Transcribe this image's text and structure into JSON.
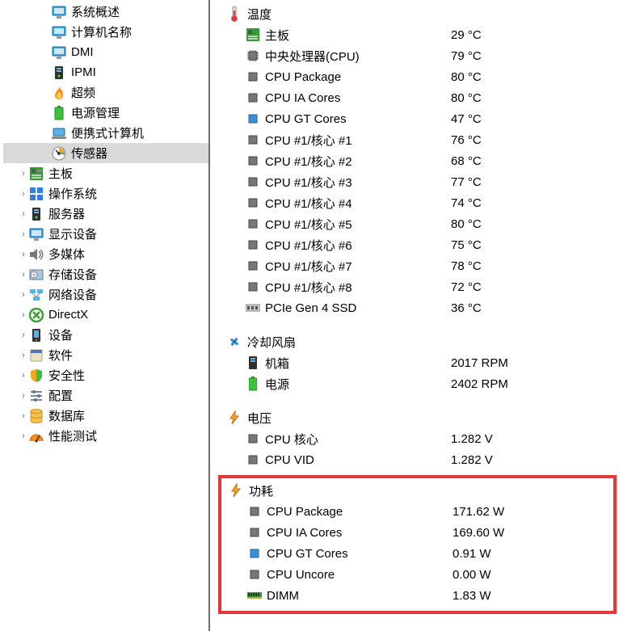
{
  "tree": {
    "overview": "系统概述",
    "computer": "计算机名称",
    "dmi": "DMI",
    "ipmi": "IPMI",
    "overclock": "超频",
    "power_mgmt": "电源管理",
    "portable": "便携式计算机",
    "sensors": "传感器",
    "mainboard": "主板",
    "os": "操作系统",
    "server": "服务器",
    "display": "显示设备",
    "multimedia": "多媒体",
    "storage": "存储设备",
    "network": "网络设备",
    "directx": "DirectX",
    "devices": "设备",
    "software": "软件",
    "security": "安全性",
    "config": "配置",
    "database": "数据库",
    "benchmark": "性能测试"
  },
  "sections": {
    "temp": {
      "title": "温度"
    },
    "cooling": {
      "title": "冷却风扇"
    },
    "voltage": {
      "title": "电压"
    },
    "power": {
      "title": "功耗"
    }
  },
  "temp": {
    "mainboard": {
      "label": "主板",
      "value": "29 °C"
    },
    "cpu": {
      "label": "中央处理器(CPU)",
      "value": "79 °C"
    },
    "cpu_pkg": {
      "label": "CPU Package",
      "value": "80 °C"
    },
    "cpu_ia": {
      "label": "CPU IA Cores",
      "value": "80 °C"
    },
    "cpu_gt": {
      "label": "CPU GT Cores",
      "value": "47 °C"
    },
    "core1": {
      "label": "CPU #1/核心 #1",
      "value": "76 °C"
    },
    "core2": {
      "label": "CPU #1/核心 #2",
      "value": "68 °C"
    },
    "core3": {
      "label": "CPU #1/核心 #3",
      "value": "77 °C"
    },
    "core4": {
      "label": "CPU #1/核心 #4",
      "value": "74 °C"
    },
    "core5": {
      "label": "CPU #1/核心 #5",
      "value": "80 °C"
    },
    "core6": {
      "label": "CPU #1/核心 #6",
      "value": "75 °C"
    },
    "core7": {
      "label": "CPU #1/核心 #7",
      "value": "78 °C"
    },
    "core8": {
      "label": "CPU #1/核心 #8",
      "value": "72 °C"
    },
    "ssd": {
      "label": "PCIe Gen 4 SSD",
      "value": "36 °C"
    }
  },
  "cooling": {
    "chassis": {
      "label": "机箱",
      "value": "2017 RPM"
    },
    "psu": {
      "label": "电源",
      "value": "2402 RPM"
    }
  },
  "voltage": {
    "cpu_core": {
      "label": "CPU 核心",
      "value": "1.282 V"
    },
    "cpu_vid": {
      "label": "CPU VID",
      "value": "1.282 V"
    }
  },
  "power": {
    "cpu_pkg": {
      "label": "CPU Package",
      "value": "171.62 W"
    },
    "cpu_ia": {
      "label": "CPU IA Cores",
      "value": "169.60 W"
    },
    "cpu_gt": {
      "label": "CPU GT Cores",
      "value": "0.91 W"
    },
    "cpu_uncore": {
      "label": "CPU Uncore",
      "value": "0.00 W"
    },
    "dimm": {
      "label": "DIMM",
      "value": "1.83 W"
    }
  }
}
